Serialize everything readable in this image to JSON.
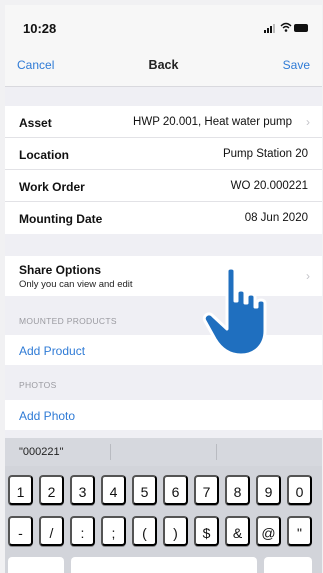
{
  "status_bar": {
    "time": "10:28"
  },
  "nav": {
    "cancel_label": "Cancel",
    "title": "Back",
    "save_label": "Save"
  },
  "details": [
    {
      "label": "Asset",
      "value": "HWP 20.001, Heat water pump",
      "chevron": true
    },
    {
      "label": "Location",
      "value": "Pump Station 20",
      "chevron": false
    },
    {
      "label": "Work Order",
      "value": "WO 20.000221",
      "chevron": false
    },
    {
      "label": "Mounting Date",
      "value": "08 Jun 2020",
      "chevron": false
    }
  ],
  "share": {
    "title": "Share Options",
    "subtitle": "Only you can view and edit"
  },
  "mounted_products": {
    "header": "MOUNTED PRODUCTS",
    "add_label": "Add Product"
  },
  "photos": {
    "header": "PHOTOS",
    "add_label": "Add Photo"
  },
  "keyboard": {
    "suggestion": "\"000221\"",
    "row1": [
      "1",
      "2",
      "3",
      "4",
      "5",
      "6",
      "7",
      "8",
      "9",
      "0"
    ],
    "row2": [
      "-",
      "/",
      ":",
      ";",
      "(",
      ")",
      "$",
      "&",
      "@",
      "\""
    ]
  },
  "colors": {
    "accent": "#2f7bd6",
    "hand": "#1f6fbf"
  },
  "icons": {
    "chevron": "chevron-right-icon",
    "cursor": "pointing-hand-icon"
  }
}
